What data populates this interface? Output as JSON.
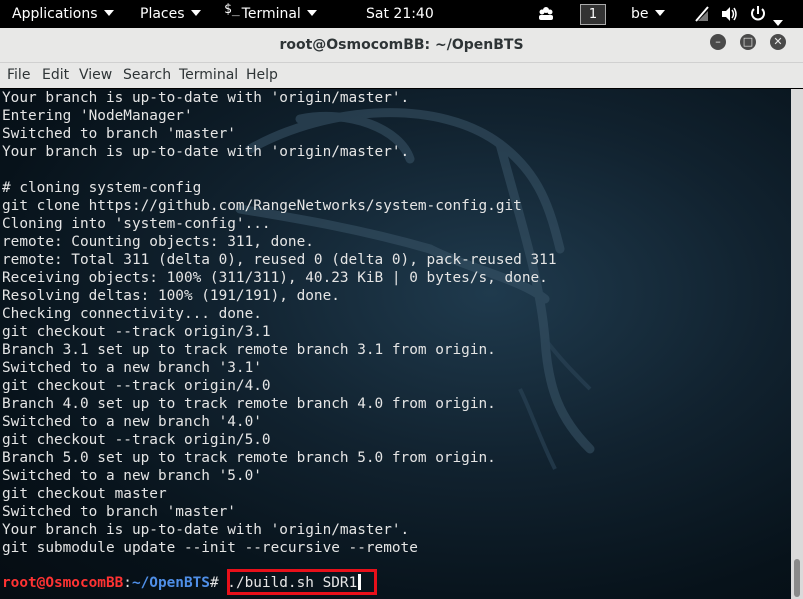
{
  "panel": {
    "applications": "Applications",
    "places": "Places",
    "terminal_glyph": "$_",
    "terminal": "Terminal",
    "clock": "Sat 21:40",
    "workspace": "1",
    "keyboard_layout": "be",
    "icons": [
      "accessibility-icon",
      "network-icon",
      "volume-icon",
      "power-icon"
    ]
  },
  "window": {
    "title": "root@OsmocomBB: ~/OpenBTS",
    "menu": [
      "File",
      "Edit",
      "View",
      "Search",
      "Terminal",
      "Help"
    ]
  },
  "terminal": {
    "lines": [
      "Your branch is up-to-date with 'origin/master'.",
      "Entering 'NodeManager'",
      "Switched to branch 'master'",
      "Your branch is up-to-date with 'origin/master'.",
      "",
      "# cloning system-config",
      "git clone https://github.com/RangeNetworks/system-config.git",
      "Cloning into 'system-config'...",
      "remote: Counting objects: 311, done.",
      "remote: Total 311 (delta 0), reused 0 (delta 0), pack-reused 311",
      "Receiving objects: 100% (311/311), 40.23 KiB | 0 bytes/s, done.",
      "Resolving deltas: 100% (191/191), done.",
      "Checking connectivity... done.",
      "git checkout --track origin/3.1",
      "Branch 3.1 set up to track remote branch 3.1 from origin.",
      "Switched to a new branch '3.1'",
      "git checkout --track origin/4.0",
      "Branch 4.0 set up to track remote branch 4.0 from origin.",
      "Switched to a new branch '4.0'",
      "git checkout --track origin/5.0",
      "Branch 5.0 set up to track remote branch 5.0 from origin.",
      "Switched to a new branch '5.0'",
      "git checkout master",
      "Switched to branch 'master'",
      "Your branch is up-to-date with 'origin/master'.",
      "git submodule update --init --recursive --remote"
    ],
    "prompt": {
      "user_host": "root@OsmocomBB",
      "colon": ":",
      "path": "~/OpenBTS",
      "symbol": "#",
      "command": " ./build.sh SDR1"
    }
  },
  "colors": {
    "prompt_user": "#ff3333",
    "prompt_path": "#4f8fe8",
    "highlight_box": "#e8101a",
    "terminal_text": "#e5e5e5"
  }
}
